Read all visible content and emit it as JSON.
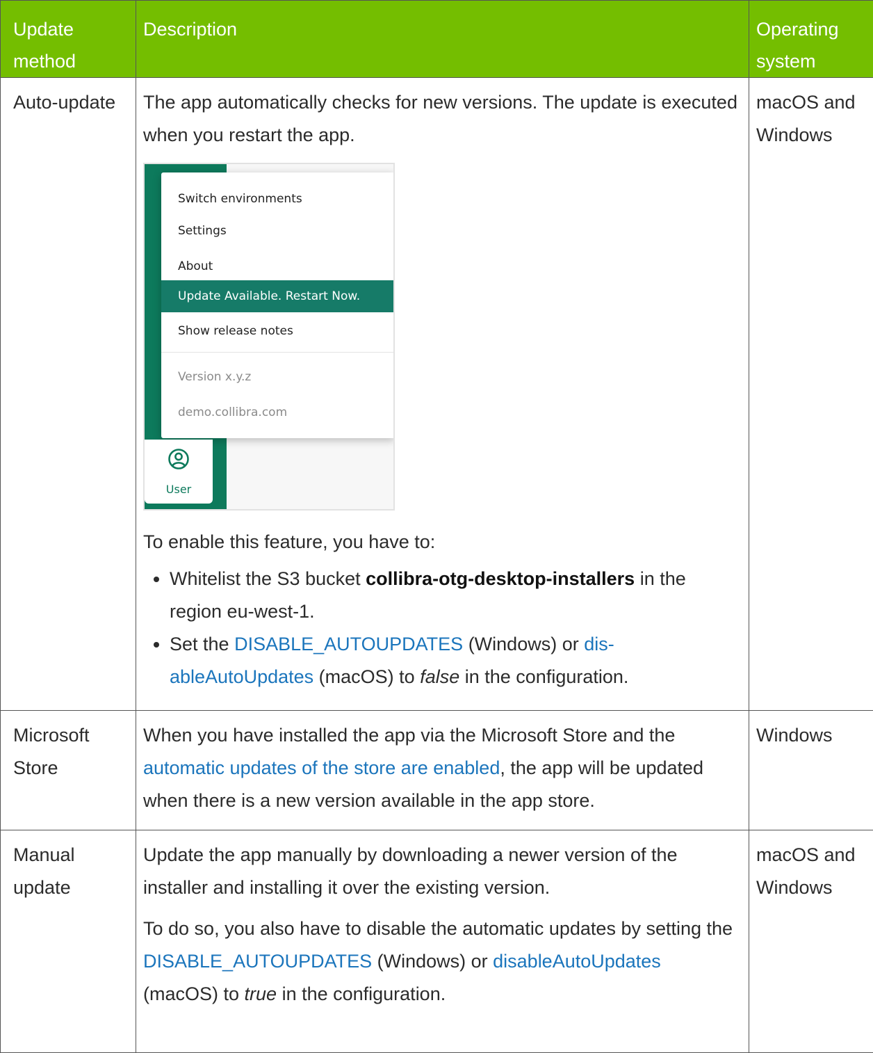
{
  "headers": {
    "method": "Update method",
    "description": "Description",
    "os": "Operating system"
  },
  "rows": [
    {
      "method": "Auto-update",
      "description_intro": "The app automatically checks for new versions. The update is executed when you restart the app.",
      "screenshot": {
        "menu_items": [
          "Switch environments",
          "Settings",
          "About",
          "Update Available. Restart Now.",
          "Show release notes"
        ],
        "version": "Version x.y.z",
        "host": "demo.collibra.com",
        "user_label": "User"
      },
      "enable_intro": "To enable this feature, you have to:",
      "bullet1_pre": "Whitelist the S3 bucket ",
      "bullet1_bold": "collibra-otg-desktop-installers",
      "bullet1_post": " in the region eu-west-1.",
      "bullet2_pre": "Set the ",
      "bullet2_link1": "DISABLE_AUTOUPDATES",
      "bullet2_mid": " (Windows) or ",
      "bullet2_link2": "dis-ableAutoUpdates",
      "bullet2_mid2": " (macOS) to ",
      "bullet2_italic": "false",
      "bullet2_post": " in the configuration.",
      "os": "macOS and Windows"
    },
    {
      "method": "Microsoft Store",
      "desc_pre": "When you have installed the app via the Microsoft Store and the ",
      "desc_link": "automatic updates of the store are enabled",
      "desc_post": ", the app will be updated when there is a new version available in the app store.",
      "os": "Windows"
    },
    {
      "method": "Manual update",
      "desc1": "Update the app manually by downloading a newer version of the installer and installing it over the existing version.",
      "desc2_pre": "To do so, you also have to disable the automatic updates by setting the ",
      "desc2_link1": "DISABLE_AUTOUPDATES",
      "desc2_mid": " (Windows) or ",
      "desc2_link2": "disableAutoUpdates",
      "desc2_mid2": " (macOS) to ",
      "desc2_italic": "true",
      "desc2_post": " in the configuration.",
      "os": "macOS and Windows"
    }
  ],
  "colors": {
    "header_bg": "#74be00",
    "link": "#1b75bc",
    "accent_green": "#0d7a5c"
  }
}
